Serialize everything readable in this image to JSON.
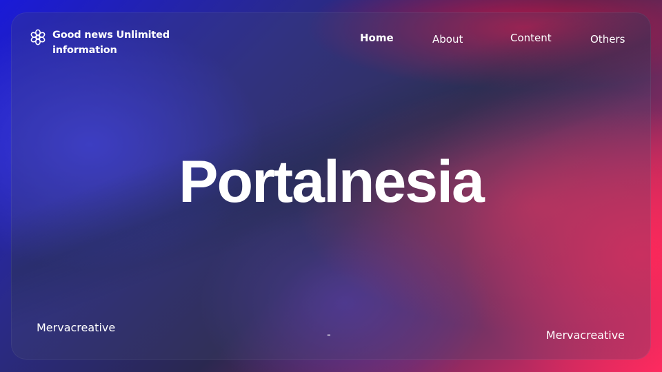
{
  "brand": {
    "icon": "flower-icon",
    "name_line1": "Good news Unlimited",
    "name_line2": "information"
  },
  "nav": {
    "items": [
      {
        "label": "Home",
        "active": true
      },
      {
        "label": "About",
        "active": false
      },
      {
        "label": "Content",
        "active": false
      },
      {
        "label": "Others",
        "active": false
      }
    ]
  },
  "hero": {
    "title": "Portalnesia"
  },
  "footer": {
    "left": "Mervacreative",
    "center": "-",
    "right": "Mervacreative"
  },
  "colors": {
    "text": "#ffffff",
    "accent_blue": "#1a1ad8",
    "accent_red": "#ff2a60"
  }
}
